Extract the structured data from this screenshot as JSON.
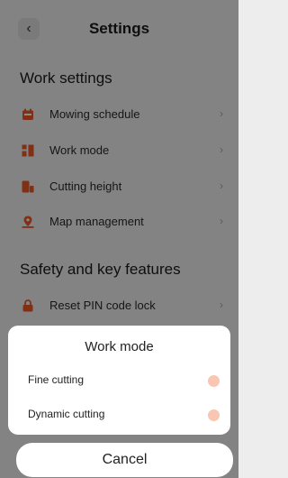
{
  "colors": {
    "accent": "#ee5a2a",
    "radio_idle": "#f8c6b3"
  },
  "header": {
    "back_icon": "‹",
    "title": "Settings"
  },
  "sections": [
    {
      "title": "Work settings",
      "items": [
        {
          "label": "Mowing schedule",
          "icon": "calendar-icon"
        },
        {
          "label": "Work mode",
          "icon": "grid-icon"
        },
        {
          "label": "Cutting height",
          "icon": "height-icon"
        },
        {
          "label": "Map management",
          "icon": "map-pin-icon"
        }
      ]
    },
    {
      "title": "Safety and key features",
      "items": [
        {
          "label": "Reset PIN code lock",
          "icon": "lock-icon"
        }
      ]
    }
  ],
  "chevron": "›",
  "sheet": {
    "title": "Work mode",
    "options": [
      {
        "label": "Fine cutting",
        "selected": false
      },
      {
        "label": "Dynamic cutting",
        "selected": false
      }
    ],
    "cancel_label": "Cancel"
  }
}
